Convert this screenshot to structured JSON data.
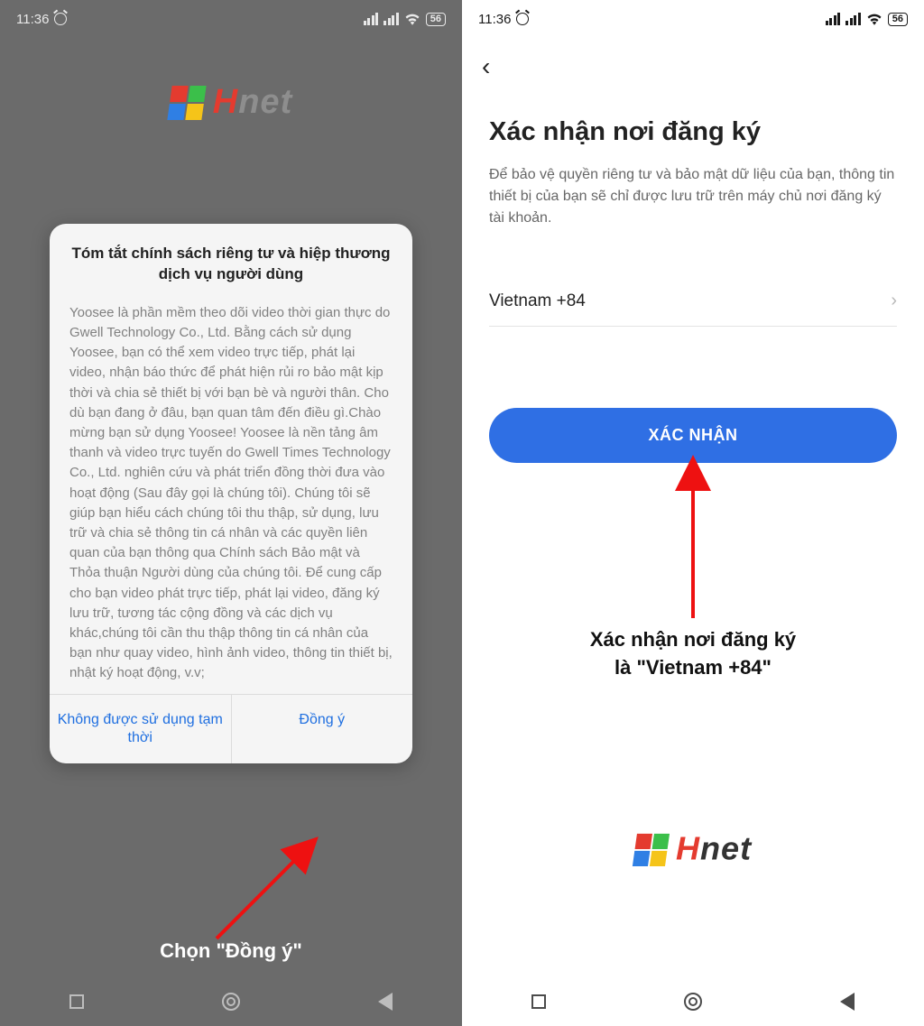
{
  "status": {
    "time": "11:36",
    "battery": "56"
  },
  "logo": {
    "h": "H",
    "net": "net"
  },
  "left": {
    "modal_title": "Tóm tắt chính sách riêng tư và hiệp thương dịch vụ người dùng",
    "modal_body": "Yoosee là phần mềm theo dõi video thời gian thực do Gwell Technology Co., Ltd. Bằng cách sử dụng Yoosee, bạn có thể xem video trực tiếp, phát lại video, nhận báo thức để phát hiện rủi ro bảo mật kịp thời và chia sẻ thiết bị với bạn bè và người thân. Cho dù bạn đang ở đâu, bạn quan tâm đến điều gì.Chào mừng bạn sử dụng Yoosee! Yoosee là nền tảng âm thanh và video trực tuyến do Gwell Times Technology Co., Ltd. nghiên cứu và phát triển đồng thời đưa vào hoạt động (Sau đây gọi là chúng tôi). Chúng tôi sẽ giúp bạn hiểu cách chúng tôi thu thập, sử dụng, lưu trữ và chia sẻ thông tin cá nhân và các quyền liên quan của bạn thông qua Chính sách Bảo mật và Thỏa thuận Người dùng của chúng tôi.\nĐể cung cấp cho bạn video phát trực tiếp, phát lại video, đăng ký lưu trữ, tương tác cộng đồng và các dịch vụ khác,chúng tôi cần thu thập thông tin cá nhân của bạn như quay video, hình ảnh video, thông tin thiết bị, nhật ký hoạt động, v.v;",
    "decline_label": "Không được sử dụng tạm thời",
    "accept_label": "Đồng ý",
    "caption": "Chọn \"Đồng ý\""
  },
  "right": {
    "title": "Xác nhận nơi đăng ký",
    "description": "Để bảo vệ quyền riêng tư và bảo mật dữ liệu của bạn, thông tin thiết bị của bạn sẽ chỉ được lưu trữ trên máy chủ nơi đăng ký tài khoản.",
    "country": "Vietnam +84",
    "confirm_label": "XÁC NHẬN",
    "caption_line1": "Xác nhận nơi đăng ký",
    "caption_line2": "là \"Vietnam +84\""
  }
}
